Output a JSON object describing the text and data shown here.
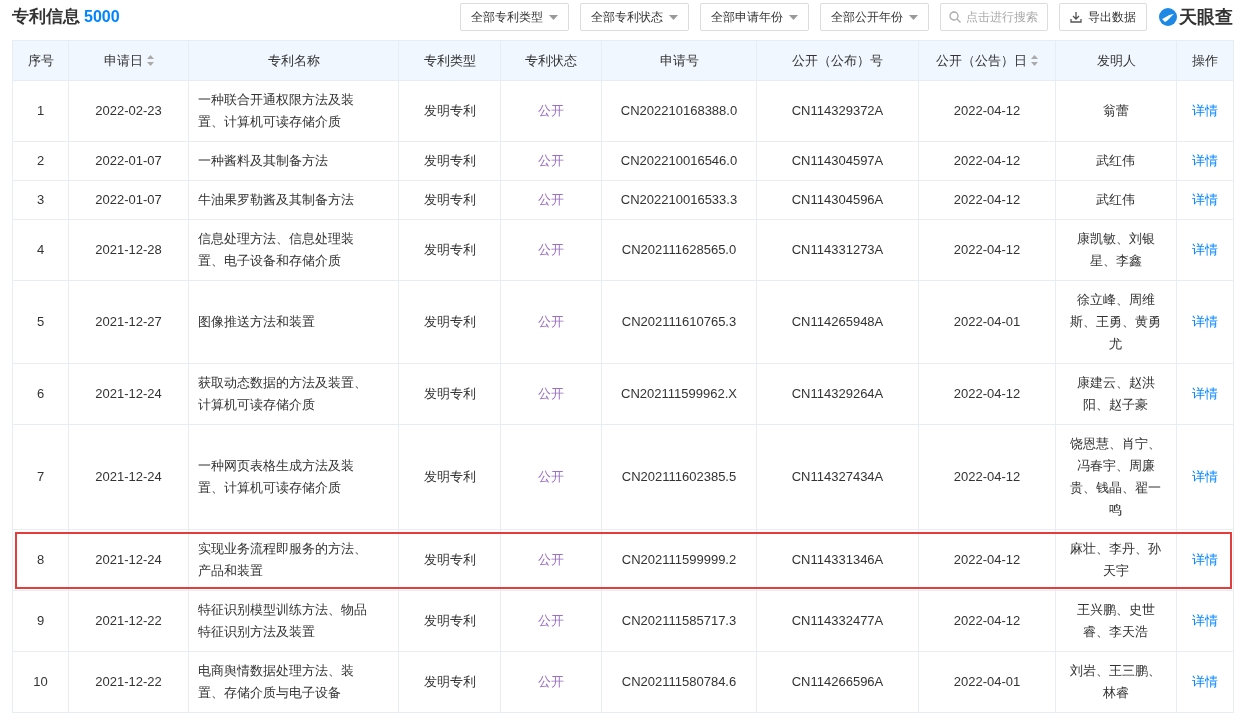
{
  "header": {
    "title": "专利信息",
    "count": "5000"
  },
  "filters": [
    {
      "label": "全部专利类型"
    },
    {
      "label": "全部专利状态"
    },
    {
      "label": "全部申请年份"
    },
    {
      "label": "全部公开年份"
    }
  ],
  "search": {
    "placeholder": "点击进行搜索"
  },
  "export_button": {
    "label": "导出数据"
  },
  "logo": {
    "text": "天眼查"
  },
  "table": {
    "columns": [
      {
        "label": "序号",
        "sortable": false
      },
      {
        "label": "申请日",
        "sortable": true
      },
      {
        "label": "专利名称",
        "sortable": false
      },
      {
        "label": "专利类型",
        "sortable": false
      },
      {
        "label": "专利状态",
        "sortable": false
      },
      {
        "label": "申请号",
        "sortable": false
      },
      {
        "label": "公开（公布）号",
        "sortable": false
      },
      {
        "label": "公开（公告）日",
        "sortable": true
      },
      {
        "label": "发明人",
        "sortable": false
      },
      {
        "label": "操作",
        "sortable": false
      }
    ],
    "rows": [
      {
        "index": "1",
        "date": "2022-02-23",
        "name": "一种联合开通权限方法及装置、计算机可读存储介质",
        "type": "发明专利",
        "status": "公开",
        "app_no": "CN202210168388.0",
        "pub_no": "CN114329372A",
        "pub_date": "2022-04-12",
        "inventors": "翁蕾",
        "action": "详情",
        "highlighted": false
      },
      {
        "index": "2",
        "date": "2022-01-07",
        "name": "一种酱料及其制备方法",
        "type": "发明专利",
        "status": "公开",
        "app_no": "CN202210016546.0",
        "pub_no": "CN114304597A",
        "pub_date": "2022-04-12",
        "inventors": "武红伟",
        "action": "详情",
        "highlighted": false
      },
      {
        "index": "3",
        "date": "2022-01-07",
        "name": "牛油果罗勒酱及其制备方法",
        "type": "发明专利",
        "status": "公开",
        "app_no": "CN202210016533.3",
        "pub_no": "CN114304596A",
        "pub_date": "2022-04-12",
        "inventors": "武红伟",
        "action": "详情",
        "highlighted": false
      },
      {
        "index": "4",
        "date": "2021-12-28",
        "name": "信息处理方法、信息处理装置、电子设备和存储介质",
        "type": "发明专利",
        "status": "公开",
        "app_no": "CN202111628565.0",
        "pub_no": "CN114331273A",
        "pub_date": "2022-04-12",
        "inventors": "康凯敏、刘银星、李鑫",
        "action": "详情",
        "highlighted": false
      },
      {
        "index": "5",
        "date": "2021-12-27",
        "name": "图像推送方法和装置",
        "type": "发明专利",
        "status": "公开",
        "app_no": "CN202111610765.3",
        "pub_no": "CN114265948A",
        "pub_date": "2022-04-01",
        "inventors": "徐立峰、周维斯、王勇、黄勇尤",
        "action": "详情",
        "highlighted": false
      },
      {
        "index": "6",
        "date": "2021-12-24",
        "name": "获取动态数据的方法及装置、计算机可读存储介质",
        "type": "发明专利",
        "status": "公开",
        "app_no": "CN202111599962.X",
        "pub_no": "CN114329264A",
        "pub_date": "2022-04-12",
        "inventors": "康建云、赵洪阳、赵子豪",
        "action": "详情",
        "highlighted": false
      },
      {
        "index": "7",
        "date": "2021-12-24",
        "name": "一种网页表格生成方法及装置、计算机可读存储介质",
        "type": "发明专利",
        "status": "公开",
        "app_no": "CN202111602385.5",
        "pub_no": "CN114327434A",
        "pub_date": "2022-04-12",
        "inventors": "饶恩慧、肖宁、冯春宇、周廉贵、钱晶、翟一鸣",
        "action": "详情",
        "highlighted": false
      },
      {
        "index": "8",
        "date": "2021-12-24",
        "name": "实现业务流程即服务的方法、产品和装置",
        "type": "发明专利",
        "status": "公开",
        "app_no": "CN202111599999.2",
        "pub_no": "CN114331346A",
        "pub_date": "2022-04-12",
        "inventors": "麻壮、李丹、孙天宇",
        "action": "详情",
        "highlighted": true
      },
      {
        "index": "9",
        "date": "2021-12-22",
        "name": "特征识别模型训练方法、物品特征识别方法及装置",
        "type": "发明专利",
        "status": "公开",
        "app_no": "CN202111585717.3",
        "pub_no": "CN114332477A",
        "pub_date": "2022-04-12",
        "inventors": "王兴鹏、史世睿、李天浩",
        "action": "详情",
        "highlighted": false
      },
      {
        "index": "10",
        "date": "2021-12-22",
        "name": "电商舆情数据处理方法、装置、存储介质与电子设备",
        "type": "发明专利",
        "status": "公开",
        "app_no": "CN202111580784.6",
        "pub_no": "CN114266596A",
        "pub_date": "2022-04-01",
        "inventors": "刘岩、王三鹏、林睿",
        "action": "详情",
        "highlighted": false
      }
    ]
  }
}
